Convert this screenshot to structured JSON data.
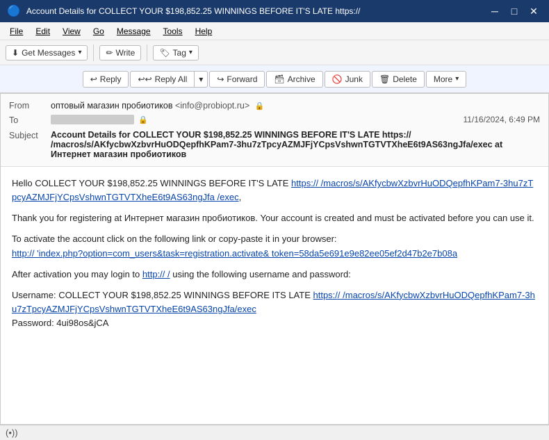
{
  "titleBar": {
    "icon": "🔵",
    "text": "Account Details for COLLECT YOUR $198,852.25 WINNINGS BEFORE IT'S LATE https://",
    "minimize": "─",
    "maximize": "□",
    "close": "✕"
  },
  "menuBar": {
    "items": [
      "File",
      "Edit",
      "View",
      "Go",
      "Message",
      "Tools",
      "Help"
    ]
  },
  "toolbar": {
    "getMessages": "Get Messages",
    "write": "Write",
    "tag": "Tag"
  },
  "actionBar": {
    "reply": "Reply",
    "replyAll": "Reply All",
    "forward": "Forward",
    "archive": "Archive",
    "junk": "Junk",
    "delete": "Delete",
    "more": "More"
  },
  "email": {
    "fromLabel": "From",
    "fromName": "оптовый магазин пробиотиков",
    "fromEmail": "<info@probiopt.ru>",
    "toLabel": "To",
    "dateTime": "11/16/2024, 6:49 PM",
    "subjectLabel": "Subject",
    "subjectText": "Account Details for COLLECT YOUR $198,852.25 WINNINGS BEFORE IT'S LATE https:// /macros/s/AKfycbwXzbvrHuODQepfhKPam7-3hu7zTpcyAZMJFjYCpsVshwnTGTVTXheE6t9AS63ngJfa/exec at Интернет магазин пробиотиков",
    "body": {
      "greeting": "Hello COLLECT YOUR $198,852.25 WINNINGS BEFORE IT'S LATE",
      "link1Text": "https:// /macros/s/AKfycbwXzbvrHuODQepfhKPam7-3hu7zTpcyAZMJFjYCpsVshwnTGTVTXheE6t9AS63ngJfa /exec",
      "paragraph1": "Thank you for registering at Интернет магазин пробиотиков. Your account is created and must be activated before you can use it.",
      "activateText": "To activate the account click on the following link or copy-paste it in your browser:",
      "link2Text": "http://                 'index.php?option=com_users&task=registration.activate& token=58da5e691e9e82ee05ef2d47b2e7b08a",
      "afterActivation": "After activation you may login to",
      "link3Text": "http://                   /",
      "afterLogin": "using the following username and password:",
      "usernameLabel": "Username: COLLECT YOUR $198,852.25 WINNINGS BEFORE ITS LATE",
      "link4Text": "https:// /macros/s/AKfycbwXzbvrHuODQepfhKPam7-3hu7zTpcyAZMJFjYCpsVshwnTGTVTXheE6t9AS63ngJfa/exec",
      "passwordLabel": "Password: 4ui98os&jCA"
    }
  },
  "statusBar": {
    "wifiSymbol": "(•))",
    "text": ""
  }
}
